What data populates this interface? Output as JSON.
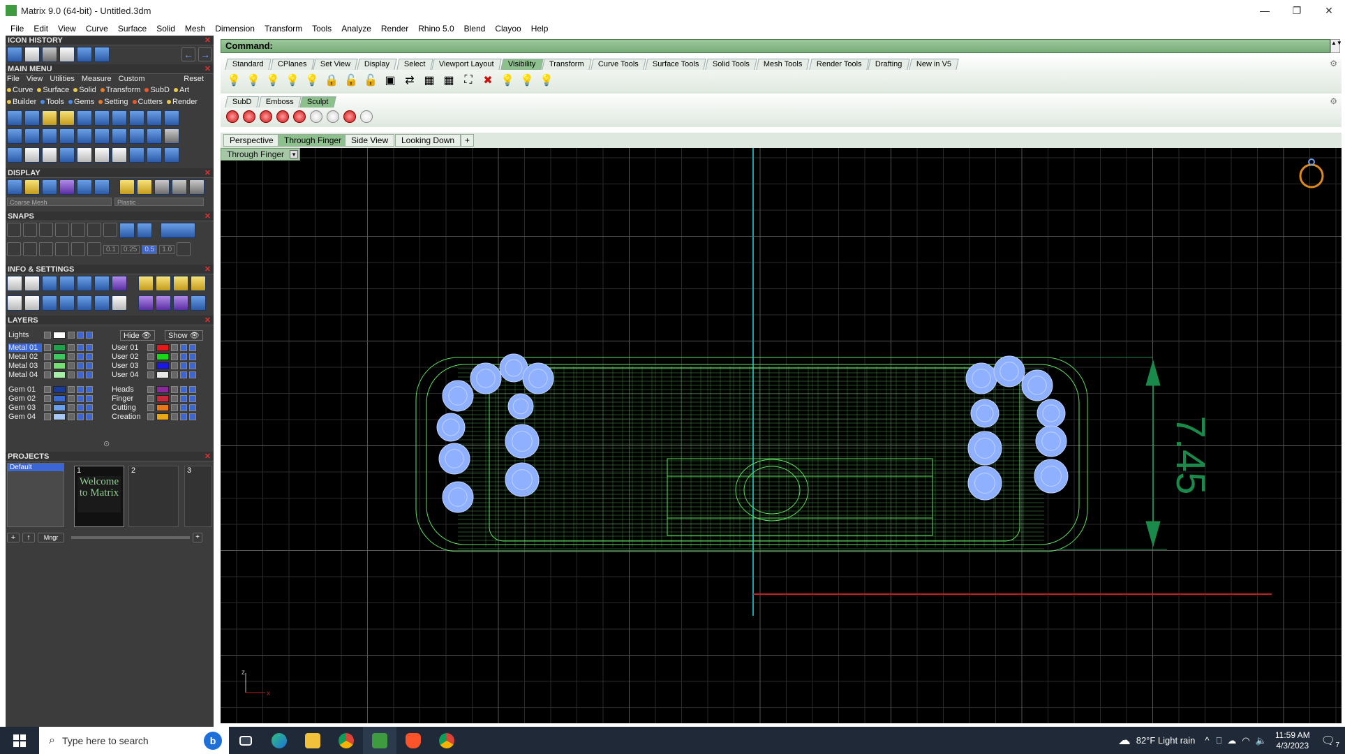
{
  "window": {
    "title": "Matrix 9.0 (64-bit) - Untitled.3dm",
    "controls": [
      "—",
      "❐",
      "✕"
    ]
  },
  "menubar": [
    "File",
    "Edit",
    "View",
    "Curve",
    "Surface",
    "Solid",
    "Mesh",
    "Dimension",
    "Transform",
    "Tools",
    "Analyze",
    "Render",
    "Rhino 5.0",
    "Blend",
    "Clayoo",
    "Help"
  ],
  "sections": {
    "icon_history": "ICON HISTORY",
    "main_menu": "MAIN MENU",
    "display": "DISPLAY",
    "snaps": "SNAPS",
    "info_settings": "INFO & SETTINGS",
    "layers": "LAYERS",
    "projects": "PROJECTS"
  },
  "main_menu": {
    "row1": [
      "File",
      "View",
      "Utilities",
      "Measure",
      "Custom"
    ],
    "reset": "Reset",
    "row2": [
      {
        "label": "Curve",
        "color": "#e8c84a"
      },
      {
        "label": "Surface",
        "color": "#e8c84a"
      },
      {
        "label": "Solid",
        "color": "#e8c84a"
      },
      {
        "label": "Transform",
        "color": "#e87b2c"
      },
      {
        "label": "SubD",
        "color": "#e85a2c"
      },
      {
        "label": "Art",
        "color": "#e8c84a"
      }
    ],
    "row3": [
      {
        "label": "Builder",
        "color": "#e8c84a"
      },
      {
        "label": "Tools",
        "color": "#4a8be8"
      },
      {
        "label": "Gems",
        "color": "#4a8be8"
      },
      {
        "label": "Setting",
        "color": "#e87b2c"
      },
      {
        "label": "Cutters",
        "color": "#e85a2c"
      },
      {
        "label": "Render",
        "color": "#e8c84a"
      }
    ]
  },
  "display": {
    "mesh": "Coarse Mesh",
    "material": "Plastic"
  },
  "snaps": {
    "values": [
      "0.1",
      "0.25",
      "0.5",
      "1.0"
    ]
  },
  "layers": {
    "lights": "Lights",
    "hide": "Hide",
    "show": "Show",
    "left": [
      {
        "name": "Metal 01",
        "color": "#1fa34a"
      },
      {
        "name": "Metal 02",
        "color": "#3cc85c"
      },
      {
        "name": "Metal 03",
        "color": "#74e074"
      },
      {
        "name": "Metal 04",
        "color": "#a6f0a6"
      },
      {
        "name": "Gem 01",
        "color": "#1a3a9a"
      },
      {
        "name": "Gem 02",
        "color": "#3a6ad4"
      },
      {
        "name": "Gem 03",
        "color": "#6aa0f0"
      },
      {
        "name": "Gem 04",
        "color": "#a6c8f6"
      }
    ],
    "right": [
      {
        "name": "User 01",
        "color": "#e81818"
      },
      {
        "name": "User 02",
        "color": "#18d818"
      },
      {
        "name": "User 03",
        "color": "#1818e8"
      },
      {
        "name": "User 04",
        "color": "#e8e8e8"
      },
      {
        "name": "Heads",
        "color": "#8a2a9a"
      },
      {
        "name": "Finger",
        "color": "#c82838"
      },
      {
        "name": "Cutting",
        "color": "#e87818"
      },
      {
        "name": "Creation",
        "color": "#e8a818"
      }
    ]
  },
  "projects": {
    "default": "Default",
    "slots": [
      "1",
      "2",
      "3"
    ],
    "thumb_text": "Welcome to Matrix",
    "mgr": "Mngr"
  },
  "command": {
    "label": "Command:"
  },
  "toolbar_tabs_1": [
    "Standard",
    "CPlanes",
    "Set View",
    "Display",
    "Select",
    "Viewport Layout",
    "Visibility",
    "Transform",
    "Curve Tools",
    "Surface Tools",
    "Solid Tools",
    "Mesh Tools",
    "Render Tools",
    "Drafting",
    "New in V5"
  ],
  "toolbar_tabs_1_active": "Visibility",
  "toolbar_tabs_2": [
    "SubD",
    "Emboss",
    "Sculpt"
  ],
  "toolbar_tabs_2_active": "Sculpt",
  "viewport_tabs": [
    "Perspective",
    "Through Finger",
    "Side View",
    "Looking Down",
    "+"
  ],
  "viewport_tabs_active": "Through Finger",
  "viewport": {
    "label": "Through Finger",
    "dimension": "7.45",
    "axis_z": "z",
    "axis_x": "x"
  },
  "colors": {
    "wire": "#5fe05f",
    "gems": "#8fb0ff",
    "dimension": "#1a8a4a",
    "axis_red": "#c02020",
    "axis_cyan": "#1ba2a8"
  },
  "taskbar": {
    "search_placeholder": "Type here to search",
    "weather": "82°F  Light rain",
    "time": "11:59 AM",
    "date": "4/3/2023",
    "notifications": "7"
  }
}
